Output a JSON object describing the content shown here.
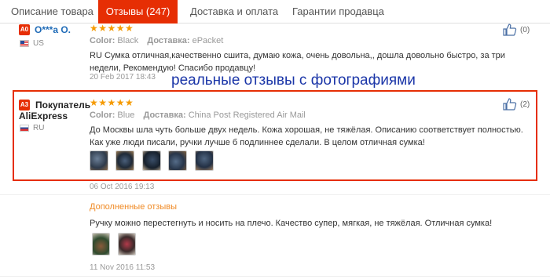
{
  "tabs": [
    {
      "label": "Описание товара"
    },
    {
      "label": "Отзывы (247)"
    },
    {
      "label": "Доставка и оплата"
    },
    {
      "label": "Гарантии продавца"
    }
  ],
  "review1": {
    "badge": "A0",
    "name": "O***a O.",
    "country": "US",
    "stars": "★★★★★",
    "color_key": "Color:",
    "color_val": "Black",
    "delivery_key": "Доставка:",
    "delivery_val": "ePacket",
    "text": "RU Сумка отличная,качественно сшита, думаю кожа, очень довольна,, дошла довольно быстро, за три недели, Рекомендую! Спасибо продавцу!",
    "date": "20 Feb 2017 18:43",
    "likes": "(0)"
  },
  "overlay": {
    "caption": "реальные отзывы с фотографиями"
  },
  "review2": {
    "badge": "A3",
    "name_line1": "Покупатель",
    "name_line2": "AliExpress",
    "country": "RU",
    "stars": "★★★★★",
    "color_key": "Color:",
    "color_val": "Blue",
    "delivery_key": "Доставка:",
    "delivery_val": "China Post Registered Air Mail",
    "text": "До Москвы шла чуть больше двух недель. Кожа хорошая, не тяжёлая. Описанию соответствует полностью. Как уже люди писали, ручки лучше б подлиннее сделали. В целом отличная сумка!",
    "date": "06 Oct 2016 19:13",
    "likes": "(2)",
    "added_title": "Дополненные отзывы",
    "added_text": "Ручку можно перестегнуть и носить на плечо. Качество супер, мягкая, не тяжёлая. Отличная сумка!",
    "added_date": "11 Nov 2016 11:53"
  },
  "colors": {
    "accent": "#e62e04",
    "link": "#1e6ab7",
    "stars": "#f59a00",
    "overlay_text": "#1b36a8",
    "added_title": "#f08a24"
  }
}
